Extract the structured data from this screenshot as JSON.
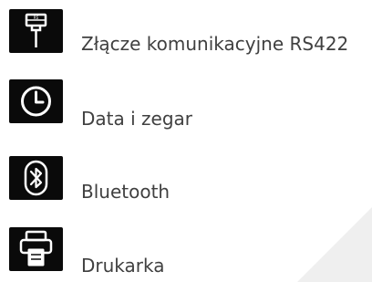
{
  "settings_list": {
    "items": [
      {
        "label": "Złącze komunikacyjne RS422",
        "icon": "rs422-connector-icon"
      },
      {
        "label": "Data i zegar",
        "icon": "clock-icon"
      },
      {
        "label": "Bluetooth",
        "icon": "bluetooth-icon"
      },
      {
        "label": "Drukarka",
        "icon": "printer-icon"
      }
    ]
  },
  "colors": {
    "icon_background": "#0a0a0a",
    "icon_foreground": "#ffffff",
    "label_text": "#404040"
  }
}
